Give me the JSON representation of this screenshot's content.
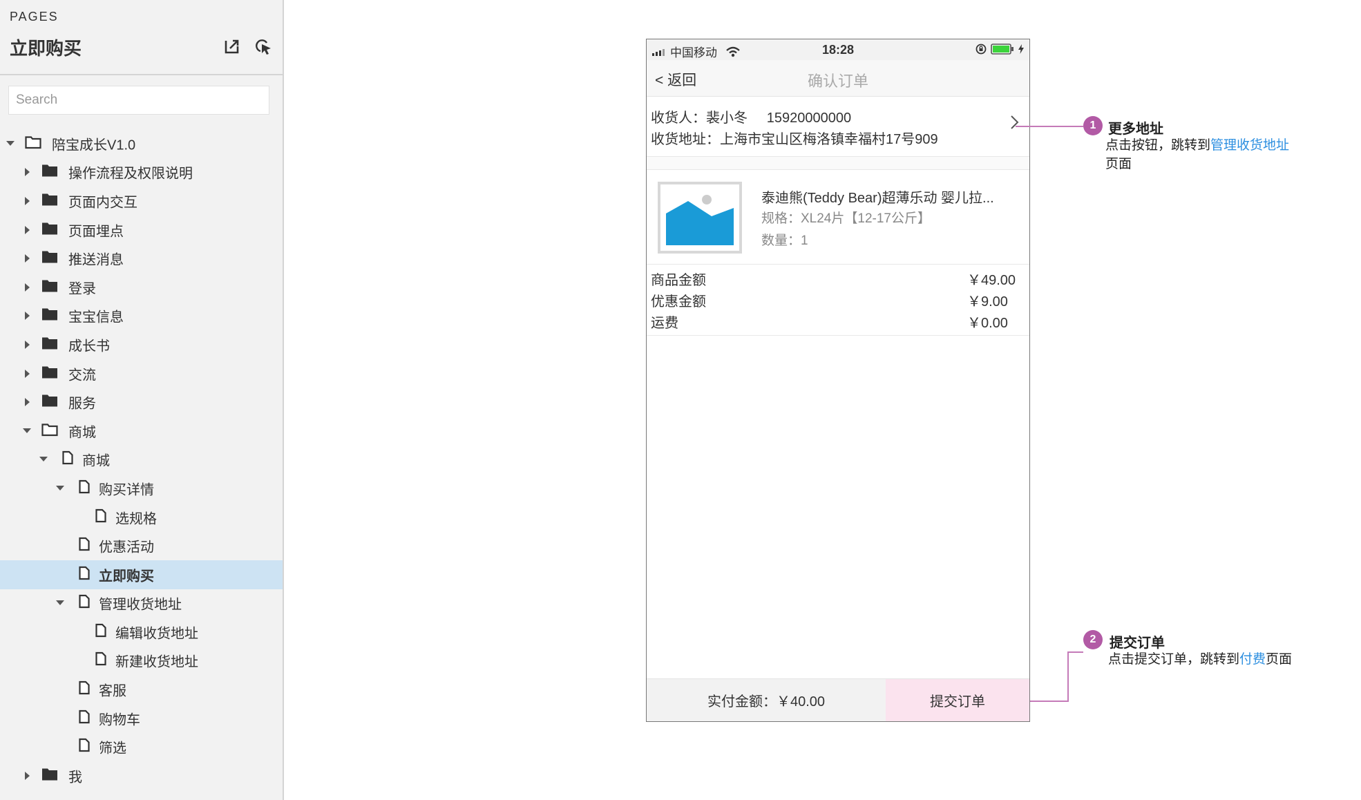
{
  "sidebar": {
    "pages_label": "PAGES",
    "title": "立即购买",
    "tools": [
      "export-icon",
      "locate-icon"
    ],
    "search": {
      "placeholder": "Search",
      "value": ""
    },
    "tree": [
      {
        "label": "陪宝成长V1.0",
        "level": 0,
        "type": "folder-open",
        "expanded": true
      },
      {
        "label": "操作流程及权限说明",
        "level": 1,
        "type": "folder",
        "expanded": false
      },
      {
        "label": "页面内交互",
        "level": 1,
        "type": "folder",
        "expanded": false
      },
      {
        "label": "页面埋点",
        "level": 1,
        "type": "folder",
        "expanded": false
      },
      {
        "label": "推送消息",
        "level": 1,
        "type": "folder",
        "expanded": false
      },
      {
        "label": "登录",
        "level": 1,
        "type": "folder",
        "expanded": false
      },
      {
        "label": "宝宝信息",
        "level": 1,
        "type": "folder",
        "expanded": false
      },
      {
        "label": "成长书",
        "level": 1,
        "type": "folder",
        "expanded": false
      },
      {
        "label": "交流",
        "level": 1,
        "type": "folder",
        "expanded": false
      },
      {
        "label": "服务",
        "level": 1,
        "type": "folder",
        "expanded": false
      },
      {
        "label": "商城",
        "level": 1,
        "type": "folder-open",
        "expanded": true
      },
      {
        "label": "商城",
        "level": 2,
        "type": "page",
        "expanded": true
      },
      {
        "label": "购买详情",
        "level": 3,
        "type": "page",
        "expanded": true
      },
      {
        "label": "选规格",
        "level": 4,
        "type": "page"
      },
      {
        "label": "优惠活动",
        "level": 3,
        "type": "page"
      },
      {
        "label": "立即购买",
        "level": 3,
        "type": "page",
        "selected": true
      },
      {
        "label": "管理收货地址",
        "level": 3,
        "type": "page",
        "expanded": true
      },
      {
        "label": "编辑收货地址",
        "level": 4,
        "type": "page"
      },
      {
        "label": "新建收货地址",
        "level": 4,
        "type": "page"
      },
      {
        "label": "客服",
        "level": 3,
        "type": "page"
      },
      {
        "label": "购物车",
        "level": 3,
        "type": "page"
      },
      {
        "label": "筛选",
        "level": 3,
        "type": "page"
      },
      {
        "label": "我",
        "level": 1,
        "type": "folder",
        "expanded": false
      }
    ]
  },
  "phone": {
    "status": {
      "carrier": "中国移动",
      "time": "18:28"
    },
    "nav": {
      "back_label": "< 返回",
      "title": "确认订单"
    },
    "address": {
      "recipient_line": "收货人：裴小冬     15920000000",
      "address_line": "收货地址：上海市宝山区梅洛镇幸福村17号909"
    },
    "product": {
      "name": "泰迪熊(Teddy Bear)超薄乐动 婴儿拉...",
      "spec": "规格：XL24片【12-17公斤】",
      "qty": "数量：1"
    },
    "costs": [
      {
        "label": "商品金额",
        "value": "￥49.00"
      },
      {
        "label": "优惠金额",
        "value": "￥9.00"
      },
      {
        "label": "运费",
        "value": "￥0.00"
      }
    ],
    "bottom": {
      "total": "实付金额：￥40.00",
      "submit": "提交订单"
    }
  },
  "annotations": [
    {
      "badge": "1",
      "title": "更多地址",
      "desc_prefix": "点击按钮，跳转到",
      "link": "管理收货地址",
      "desc_suffix": "页面"
    },
    {
      "badge": "2",
      "title": "提交订单",
      "desc_prefix": "点击提交订单，跳转到",
      "link": "付费",
      "desc_suffix": "页面"
    }
  ],
  "colors": {
    "selected_row": "#cde3f3",
    "annotation_badge": "#b25aa5",
    "link": "#2d8fe0",
    "submit_bg": "#fbe3ee",
    "image_placeholder": "#1a9bd7"
  }
}
